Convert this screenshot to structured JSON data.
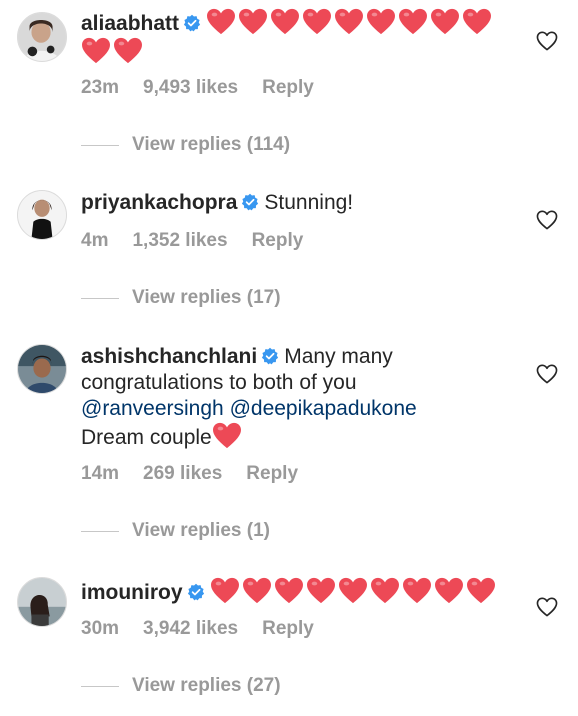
{
  "comments": [
    {
      "username": "aliaabhatt",
      "verified": true,
      "text": "",
      "hearts": 11,
      "time": "23m",
      "likes": "9,493 likes",
      "reply": "Reply",
      "view_replies": "View replies (114)"
    },
    {
      "username": "priyankachopra",
      "verified": true,
      "text": "Stunning!",
      "hearts": 0,
      "time": "4m",
      "likes": "1,352 likes",
      "reply": "Reply",
      "view_replies": "View replies (17)"
    },
    {
      "username": "ashishchanchlani",
      "verified": true,
      "text_line1": "Many many",
      "text_line2": "congratulations to both of you",
      "mention1": "@ranveersingh",
      "mention2": "@deepikapadukone",
      "text_line4": "Dream couple",
      "hearts": 1,
      "time": "14m",
      "likes": "269 likes",
      "reply": "Reply",
      "view_replies": "View replies (1)"
    },
    {
      "username": "imouniroy",
      "verified": true,
      "text": "",
      "hearts": 9,
      "time": "30m",
      "likes": "3,942 likes",
      "reply": "Reply",
      "view_replies": "View replies (27)"
    }
  ],
  "colors": {
    "heart": "#ed4956",
    "verified": "#3897f0",
    "meta": "#999999",
    "mention": "#003569"
  },
  "icons": {
    "like": "heart-outline-icon",
    "verified": "verified-badge-icon",
    "heart": "red-heart-emoji"
  }
}
